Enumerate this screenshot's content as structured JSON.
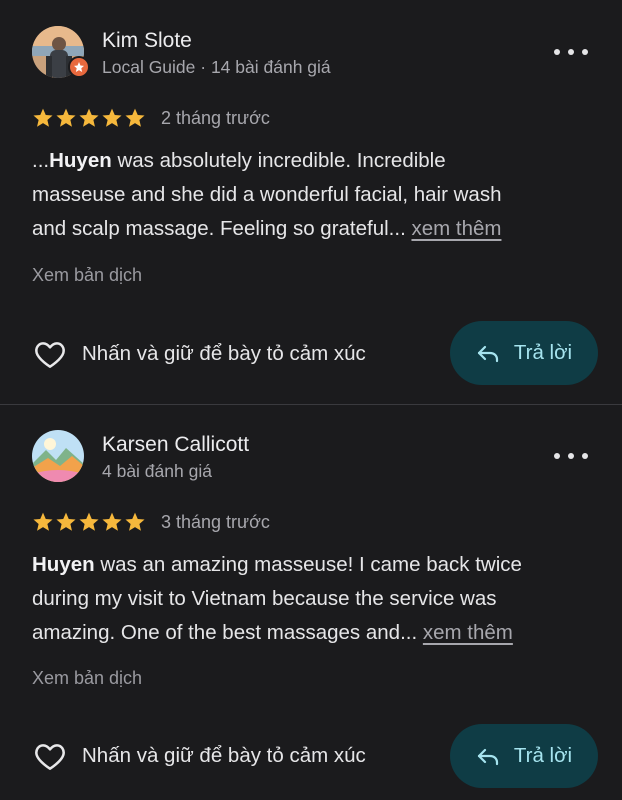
{
  "reviews": [
    {
      "name": "Kim Slote",
      "sub": "Local Guide · 14 bài đánh giá",
      "rating": 5,
      "time": "2 tháng trước",
      "lines": [
        {
          "pre": "...",
          "bold": "Huyen",
          "post": " was absolutely incredible. Incredible"
        },
        {
          "pre": "masseuse and she did a wonderful facial, hair wash",
          "bold": "",
          "post": ""
        },
        {
          "pre": "and scalp massage. Feeling so grateful... ",
          "bold": "",
          "post": ""
        }
      ],
      "see_more": "xem thêm",
      "translate": "Xem bản dịch",
      "react_label": "Nhấn và giữ để bày tỏ cảm xúc",
      "reply_label": "Trả lời",
      "avatar_icon": "profile-photo",
      "badge_icon": "local-guide-star-icon"
    },
    {
      "name": "Karsen Callicott",
      "sub": "4 bài đánh giá",
      "rating": 5,
      "time": "3 tháng trước",
      "lines": [
        {
          "pre": "",
          "bold": "Huyen",
          "post": " was an amazing masseuse! I came back twice"
        },
        {
          "pre": "during my visit to Vietnam because the service was",
          "bold": "",
          "post": ""
        },
        {
          "pre": "amazing. One of the best massages and... ",
          "bold": "",
          "post": ""
        }
      ],
      "see_more": "xem thêm",
      "translate": "Xem bản dịch",
      "react_label": "Nhấn và giữ để bày tỏ cảm xúc",
      "reply_label": "Trả lời",
      "avatar_icon": "mountain-landscape-avatar"
    }
  ],
  "colors": {
    "background": "#1b1b1d",
    "star": "#f6b83c",
    "reply_bg": "#0f3c45",
    "reply_text": "#a6e4ef",
    "badge": "#e8693e"
  }
}
